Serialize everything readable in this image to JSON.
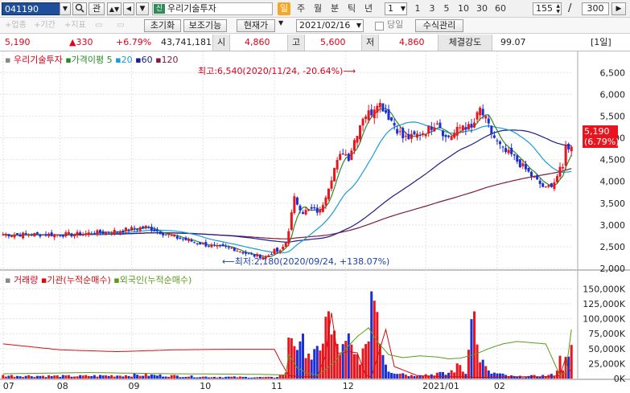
{
  "toolbar": {
    "stock_code": "041190",
    "gwan": "관",
    "stock_name": "우리기술투자",
    "sin_badge": "신",
    "periods": [
      "일",
      "주",
      "월",
      "분",
      "틱",
      "년"
    ],
    "period_selected": "일",
    "count_select": "1",
    "min_options": [
      "1",
      "3",
      "5",
      "10",
      "30",
      "60"
    ],
    "range_input": "155",
    "range_sep": "/",
    "range_total": "300"
  },
  "toolbar2": {
    "cap1": "+업종",
    "cap2": "+기간",
    "cap3": "+지표",
    "reset": "초기화",
    "aux": "보조기능",
    "current_price": "현재가",
    "date": "2021/02/16",
    "today_label": "당일",
    "formula": "수식관리"
  },
  "quote": {
    "price": "5,190",
    "change": "▲330",
    "change_pct": "+6.79%",
    "volume": "43,741,181",
    "open_label": "시",
    "open": "4,860",
    "high_label": "고",
    "high": "5,600",
    "low_label": "저",
    "low": "4,860",
    "strength_label": "체결강도",
    "strength": "99.07",
    "period_tag": "[1일]"
  },
  "legend": {
    "name": "우리기술투자",
    "ma_title": "가격이평",
    "ma5": "5",
    "ma20": "20",
    "ma60": "60",
    "ma120": "120",
    "vol_title": "거래량",
    "inst_title": "기관(누적순매수)",
    "foreign_title": "외국인(누적순매수)"
  },
  "annotations": {
    "high": "최고:6,540(2020/11/24, -20.64%)",
    "low": "최저:2,180(2020/09/24, +138.07%)",
    "last_price": "5,190",
    "last_pct": "(6.79%)"
  },
  "chart_data": {
    "type": "candlestick",
    "price_axis": {
      "ticks": [
        "6,500",
        "6,000",
        "5,500",
        "5,000",
        "4,500",
        "4,000",
        "3,500",
        "3,000",
        "2,500",
        "2,000"
      ],
      "range": [
        2000,
        6800
      ]
    },
    "volume_axis": {
      "ticks": [
        "150,000K",
        "125,000K",
        "100,000K",
        "75,000K",
        "50,000K",
        "25,000K",
        "0K"
      ],
      "range": [
        0,
        160000
      ]
    },
    "x_labels": [
      "07",
      "08",
      "09",
      "10",
      "11",
      "12",
      "2021/01",
      "02"
    ],
    "colors": {
      "up": "#e8141e",
      "down": "#1c2fd6",
      "ma5": "#2a8a2a",
      "ma20": "#1c9ad6",
      "ma60": "#1d1d8a",
      "ma120": "#7d1d3a",
      "inst": "#d01010",
      "foreign": "#5a9a1a"
    },
    "price_keypoints": [
      [
        0,
        2780
      ],
      [
        25,
        2780
      ],
      [
        40,
        2860
      ],
      [
        50,
        2950
      ],
      [
        60,
        2720
      ],
      [
        70,
        2560
      ],
      [
        75,
        2480
      ],
      [
        80,
        2470
      ],
      [
        87,
        2300
      ],
      [
        92,
        2260
      ],
      [
        95,
        2400
      ],
      [
        97,
        2380
      ],
      [
        99,
        2600
      ],
      [
        100,
        2900
      ],
      [
        102,
        3600
      ],
      [
        105,
        3300
      ],
      [
        108,
        3350
      ],
      [
        111,
        3300
      ],
      [
        113,
        3700
      ],
      [
        116,
        4300
      ],
      [
        119,
        4700
      ],
      [
        121,
        4550
      ],
      [
        123,
        4950
      ],
      [
        126,
        5500
      ],
      [
        129,
        5600
      ],
      [
        131,
        5850
      ],
      [
        133,
        5700
      ],
      [
        135,
        5500
      ],
      [
        137,
        5300
      ],
      [
        140,
        5000
      ],
      [
        143,
        5000
      ],
      [
        146,
        5100
      ],
      [
        149,
        5200
      ],
      [
        152,
        5400
      ],
      [
        155,
        5000
      ],
      [
        158,
        5100
      ],
      [
        161,
        5300
      ],
      [
        164,
        5200
      ],
      [
        167,
        5650
      ],
      [
        169,
        5400
      ],
      [
        171,
        5100
      ],
      [
        173,
        4900
      ],
      [
        175,
        4700
      ],
      [
        178,
        4600
      ],
      [
        181,
        4400
      ],
      [
        184,
        4200
      ],
      [
        187,
        4000
      ],
      [
        190,
        3820
      ],
      [
        193,
        4000
      ],
      [
        195,
        4250
      ],
      [
        196,
        4300
      ],
      [
        197,
        4900
      ],
      [
        198,
        4700
      ],
      [
        199,
        4860
      ]
    ],
    "volume_keypoints": [
      [
        0,
        5000
      ],
      [
        25,
        4000
      ],
      [
        50,
        6000
      ],
      [
        70,
        3000
      ],
      [
        95,
        2000
      ],
      [
        99,
        8000
      ],
      [
        100,
        80000
      ],
      [
        102,
        70000
      ],
      [
        104,
        45000
      ],
      [
        106,
        62000
      ],
      [
        108,
        38000
      ],
      [
        111,
        38000
      ],
      [
        113,
        120000
      ],
      [
        115,
        70000
      ],
      [
        117,
        55000
      ],
      [
        119,
        45000
      ],
      [
        121,
        58000
      ],
      [
        123,
        35000
      ],
      [
        125,
        40000
      ],
      [
        127,
        40000
      ],
      [
        129,
        150000
      ],
      [
        131,
        125000
      ],
      [
        133,
        45000
      ],
      [
        135,
        15000
      ],
      [
        137,
        12000
      ],
      [
        140,
        9000
      ],
      [
        143,
        5000
      ],
      [
        146,
        8000
      ],
      [
        149,
        6000
      ],
      [
        152,
        9000
      ],
      [
        155,
        7000
      ],
      [
        158,
        15000
      ],
      [
        160,
        22000
      ],
      [
        162,
        8000
      ],
      [
        164,
        150000
      ],
      [
        166,
        50000
      ],
      [
        168,
        25000
      ],
      [
        170,
        10000
      ],
      [
        173,
        8000
      ],
      [
        176,
        5000
      ],
      [
        180,
        3000
      ],
      [
        185,
        4000
      ],
      [
        190,
        5000
      ],
      [
        193,
        6000
      ],
      [
        195,
        30000
      ],
      [
        196,
        20000
      ],
      [
        197,
        55000
      ],
      [
        198,
        28000
      ],
      [
        199,
        44000
      ]
    ],
    "inst_keypoints": [
      [
        0,
        58000
      ],
      [
        20,
        48000
      ],
      [
        40,
        45000
      ],
      [
        60,
        48000
      ],
      [
        80,
        49000
      ],
      [
        95,
        49000
      ],
      [
        97,
        30000
      ],
      [
        100,
        5000
      ],
      [
        105,
        3000
      ],
      [
        110,
        3000
      ],
      [
        113,
        40000
      ],
      [
        115,
        110000
      ],
      [
        117,
        42000
      ],
      [
        121,
        45000
      ],
      [
        124,
        43000
      ],
      [
        127,
        5000
      ],
      [
        129,
        3000
      ],
      [
        134,
        82000
      ],
      [
        137,
        20000
      ],
      [
        145,
        5000
      ],
      [
        155,
        3000
      ],
      [
        162,
        3000
      ],
      [
        165,
        2000
      ],
      [
        170,
        2000
      ],
      [
        180,
        3000
      ],
      [
        190,
        3000
      ],
      [
        195,
        5000
      ],
      [
        197,
        35000
      ],
      [
        198,
        15000
      ],
      [
        199,
        12000
      ]
    ],
    "foreign_keypoints": [
      [
        0,
        8000
      ],
      [
        30,
        10000
      ],
      [
        60,
        8000
      ],
      [
        90,
        7000
      ],
      [
        99,
        6000
      ],
      [
        100,
        40000
      ],
      [
        103,
        18000
      ],
      [
        106,
        10000
      ],
      [
        110,
        6000
      ],
      [
        113,
        15000
      ],
      [
        116,
        28000
      ],
      [
        120,
        50000
      ],
      [
        124,
        70000
      ],
      [
        128,
        85000
      ],
      [
        131,
        62000
      ],
      [
        135,
        40000
      ],
      [
        140,
        35000
      ],
      [
        146,
        38000
      ],
      [
        152,
        36000
      ],
      [
        156,
        33000
      ],
      [
        160,
        34000
      ],
      [
        165,
        40000
      ],
      [
        170,
        50000
      ],
      [
        175,
        58000
      ],
      [
        180,
        62000
      ],
      [
        185,
        60000
      ],
      [
        190,
        58000
      ],
      [
        195,
        5000
      ],
      [
        197,
        10000
      ],
      [
        199,
        82000
      ]
    ]
  }
}
